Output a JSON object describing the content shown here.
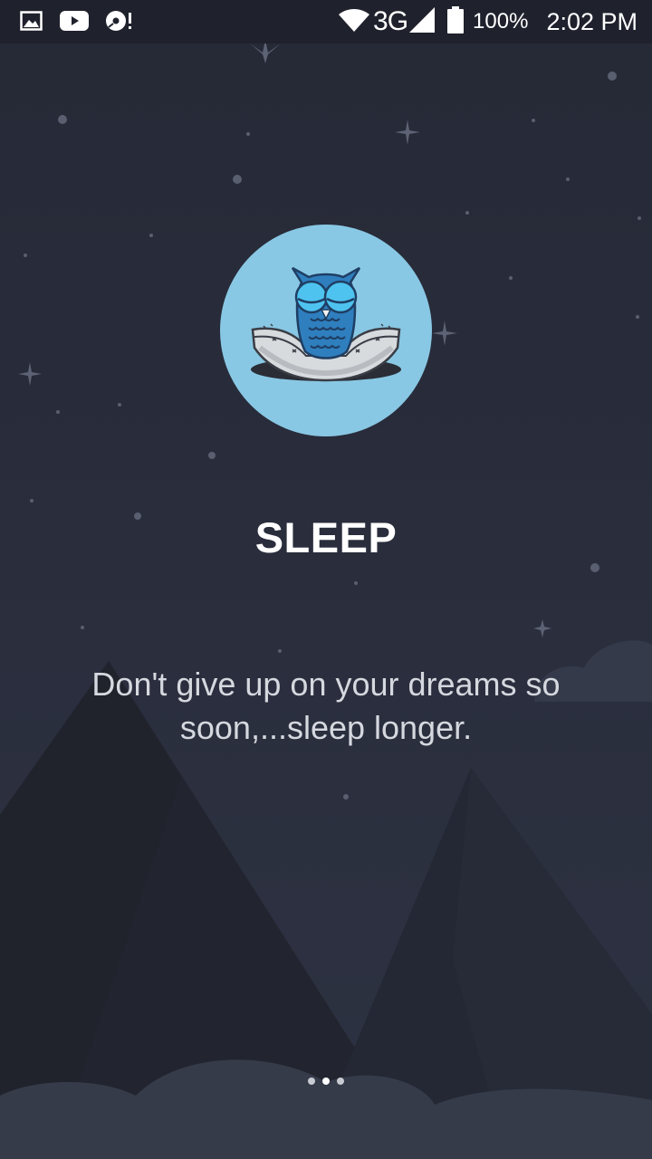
{
  "status_bar": {
    "left_icons": [
      "image-icon",
      "youtube-icon",
      "disc-alert-icon"
    ],
    "network": "3G",
    "battery_percent": "100%",
    "time": "2:02 PM"
  },
  "onboarding": {
    "icon": "sleeping-owl-icon",
    "title": "SLEEP",
    "subtitle": "Don't give up on your dreams so soon,...sleep longer.",
    "page_indicator": {
      "total": 3,
      "active_index": 1
    }
  },
  "colors": {
    "background": "#262a38",
    "badge": "#89c8e4",
    "owl": "#2f7fbf",
    "owl_eyes": "#4ec3ef",
    "title": "#ffffff",
    "subtitle": "#d5d8de"
  }
}
